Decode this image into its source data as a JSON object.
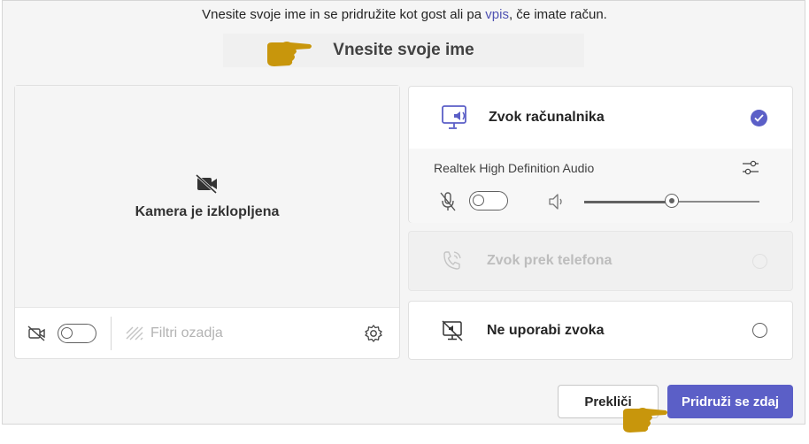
{
  "header": {
    "intro_before": "Vnesite svoje ime in se pridružite kot gost ali pa ",
    "intro_link": "vpis",
    "intro_after": ", če imate račun.",
    "name_placeholder": "Vnesite svoje ime"
  },
  "video": {
    "camera_off_label": "Kamera je izklopljena",
    "camera_toggle_on": false,
    "filters_label": "Filtri ozadja"
  },
  "audio": {
    "computer": {
      "title": "Zvok računalnika",
      "selected": true,
      "device": "Realtek High Definition Audio",
      "mic_toggle_on": false,
      "speaker_volume": 0.5
    },
    "phone": {
      "title": "Zvok prek telefona",
      "enabled": false
    },
    "none": {
      "title": "Ne uporabi zvoka",
      "selected": false
    }
  },
  "actions": {
    "cancel_label": "Prekliči",
    "join_label": "Pridruži se zdaj"
  },
  "colors": {
    "accent": "#5b5fc7",
    "annotation_hand": "#c8960c"
  }
}
